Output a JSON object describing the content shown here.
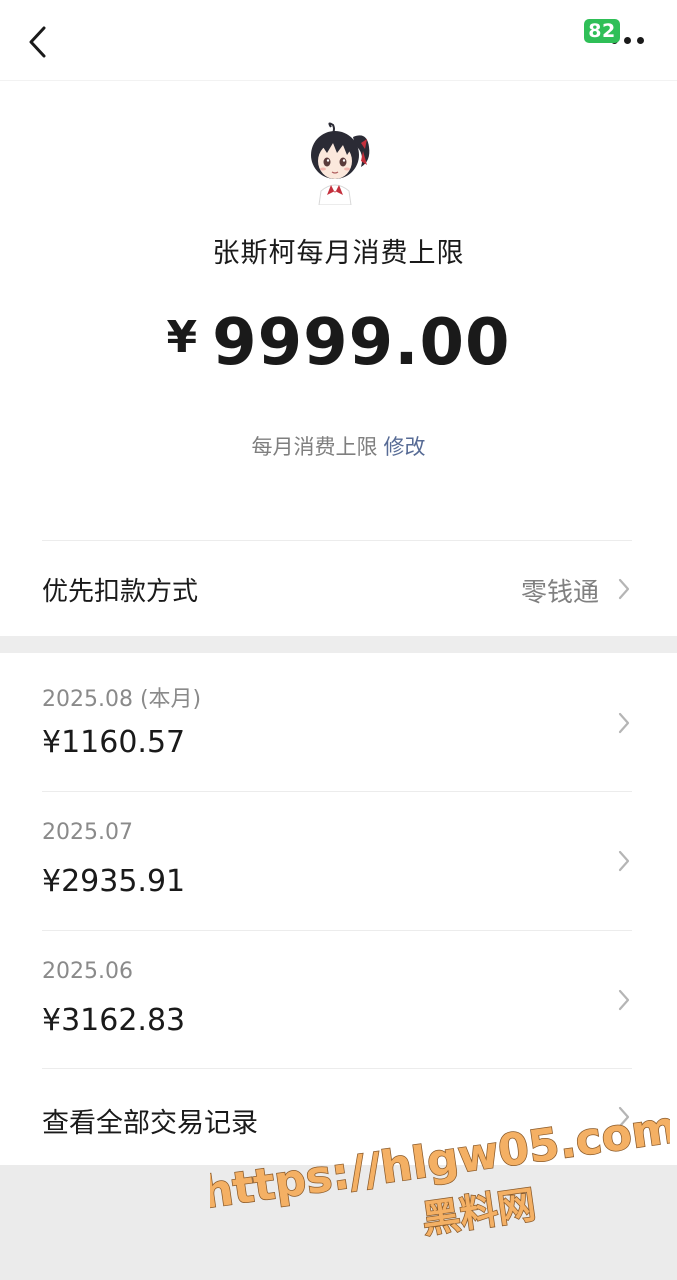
{
  "status_bar": {
    "battery": "82"
  },
  "header": {
    "title": "张斯柯每月消费上限",
    "amount_symbol": "¥",
    "amount_value": "9999.00",
    "subtitle": "每月消费上限",
    "edit_label": "修改"
  },
  "payment": {
    "label": "优先扣款方式",
    "value": "零钱通"
  },
  "months": [
    {
      "label": "2025.08 (本月)",
      "amount": "¥1160.57"
    },
    {
      "label": "2025.07",
      "amount": "¥2935.91"
    },
    {
      "label": "2025.06",
      "amount": "¥3162.83"
    }
  ],
  "all_records_label": "查看全部交易记录",
  "watermark": {
    "url": "https://hlgw05.com",
    "name": "黑料网"
  },
  "colors": {
    "link": "#576b95",
    "battery": "#2fbf57",
    "watermark_fill": "#f4b064"
  }
}
